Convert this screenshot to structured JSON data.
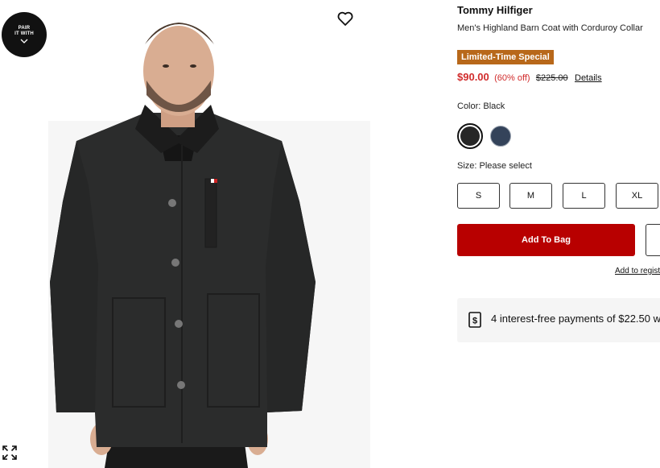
{
  "gallery": {
    "pair_badge": {
      "line1": "PAIR",
      "line2": "IT WITH"
    },
    "favorite_icon": "heart-outline-icon",
    "expand_icon": "expand-arrows-icon",
    "image_alt": "Men's Highland Barn Coat with Corduroy Collar"
  },
  "product": {
    "brand": "Tommy Hilfiger",
    "title": "Men's Highland Barn Coat with Corduroy Collar",
    "promo_badge": "Limited-Time Special",
    "price": {
      "sale": "$90.00",
      "discount": "(60% off)",
      "original": "$225.00",
      "details_link": "Details"
    },
    "color": {
      "label": "Color: Black",
      "swatches": [
        {
          "name": "Black",
          "hex": "#262626",
          "selected": true
        },
        {
          "name": "Navy",
          "hex": "#34435a",
          "selected": false
        }
      ]
    },
    "size": {
      "label": "Size: Please select",
      "options": [
        "S",
        "M",
        "L",
        "XL"
      ]
    },
    "add_to_bag": "Add To Bag",
    "registry_link": "Add to regist",
    "installments": "4 interest-free payments of $22.50 w"
  },
  "colors": {
    "sale_red": "#d12c2c",
    "button_red": "#b80000",
    "promo_orange": "#b8681a"
  }
}
